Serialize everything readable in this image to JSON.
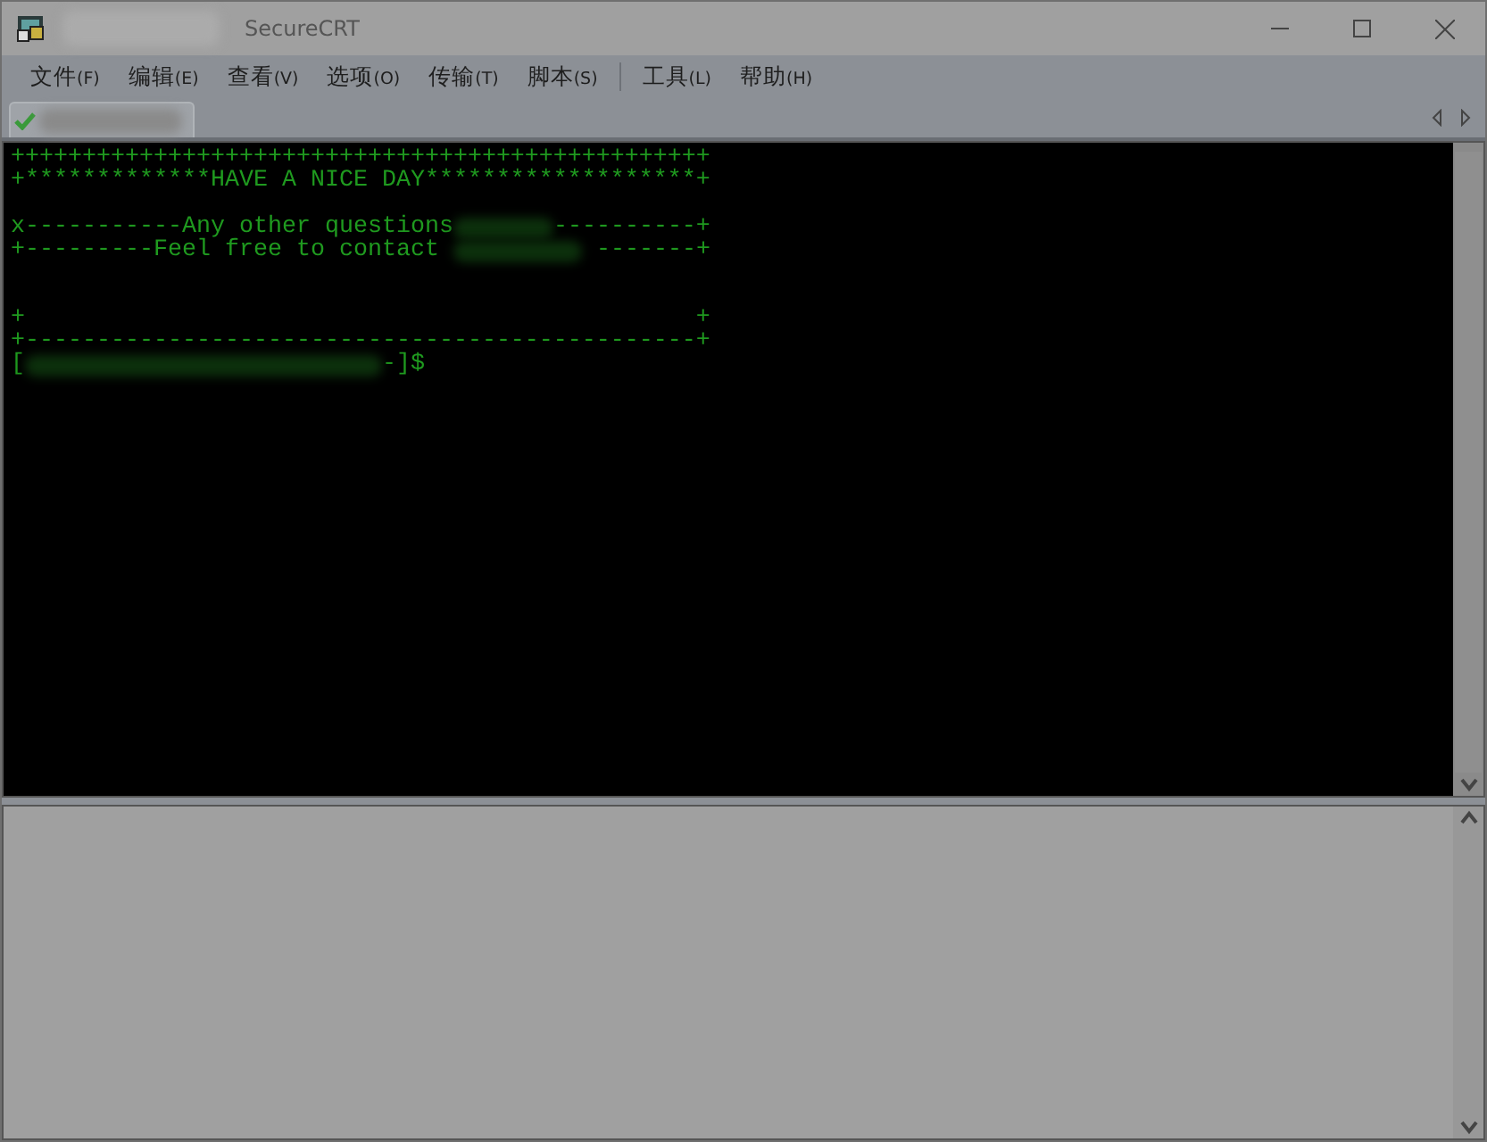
{
  "window": {
    "title": "SecureCRT"
  },
  "menu": [
    {
      "kind": "item",
      "label": "文件",
      "accel": "(F)"
    },
    {
      "kind": "item",
      "label": "编辑",
      "accel": "(E)"
    },
    {
      "kind": "item",
      "label": "查看",
      "accel": "(V)"
    },
    {
      "kind": "item",
      "label": "选项",
      "accel": "(O)"
    },
    {
      "kind": "item",
      "label": "传输",
      "accel": "(T)"
    },
    {
      "kind": "item",
      "label": "脚本",
      "accel": "(S)"
    },
    {
      "kind": "separator"
    },
    {
      "kind": "item",
      "label": "工具",
      "accel": "(L)"
    },
    {
      "kind": "item",
      "label": "帮助",
      "accel": "(H)"
    }
  ],
  "session_tabs": [
    {
      "selected": true,
      "connected": true
    }
  ],
  "terminal": {
    "lines": [
      {
        "kind": "frame",
        "segments": [
          {
            "kind": "text",
            "text": "+++++++++++++++++++++++++++++++++++++++++++++++++"
          }
        ]
      },
      {
        "kind": "frame",
        "segments": [
          {
            "kind": "text",
            "text": "+*************HAVE A NICE DAY*******************+"
          }
        ]
      },
      {
        "kind": "blank"
      },
      {
        "kind": "frame",
        "segments": [
          {
            "kind": "text",
            "text": "x-----------Any other questions"
          },
          {
            "kind": "blur"
          },
          {
            "kind": "text",
            "text": "----------+"
          }
        ]
      },
      {
        "kind": "frame",
        "segments": [
          {
            "kind": "text",
            "text": "+---------Feel free to contact "
          },
          {
            "kind": "blur"
          },
          {
            "kind": "text",
            "text": " -------+"
          }
        ]
      },
      {
        "kind": "blank"
      },
      {
        "kind": "blank"
      },
      {
        "kind": "frame",
        "segments": [
          {
            "kind": "text",
            "text": "+                                               +"
          }
        ]
      },
      {
        "kind": "frame",
        "segments": [
          {
            "kind": "text",
            "text": "+-----------------------------------------------+"
          }
        ]
      },
      {
        "kind": "prompt",
        "segments": [
          {
            "kind": "text",
            "text": "["
          },
          {
            "kind": "blur"
          },
          {
            "kind": "text",
            "text": "-]$"
          }
        ]
      }
    ]
  }
}
